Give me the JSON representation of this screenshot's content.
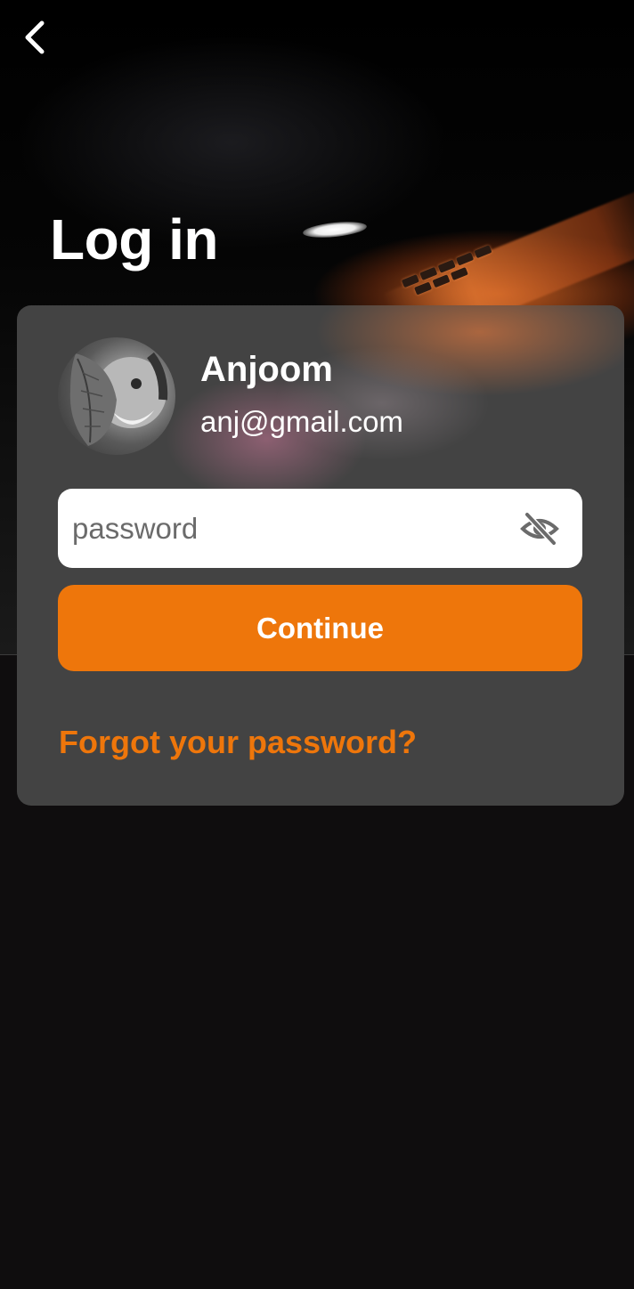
{
  "screen": {
    "title": "Log in"
  },
  "navigation": {
    "back_icon": "chevron-left-icon"
  },
  "user": {
    "name": "Anjoom",
    "email": "anj@gmail.com",
    "avatar_icon": "avatar-photo"
  },
  "form": {
    "password_placeholder": "password",
    "password_value": "",
    "visibility_icon": "eye-off-icon",
    "continue_label": "Continue",
    "forgot_label": "Forgot your password?"
  },
  "colors": {
    "accent": "#ee760b",
    "card_background": "#434343",
    "page_background": "#0f0d0e",
    "text_primary": "#ffffff"
  }
}
